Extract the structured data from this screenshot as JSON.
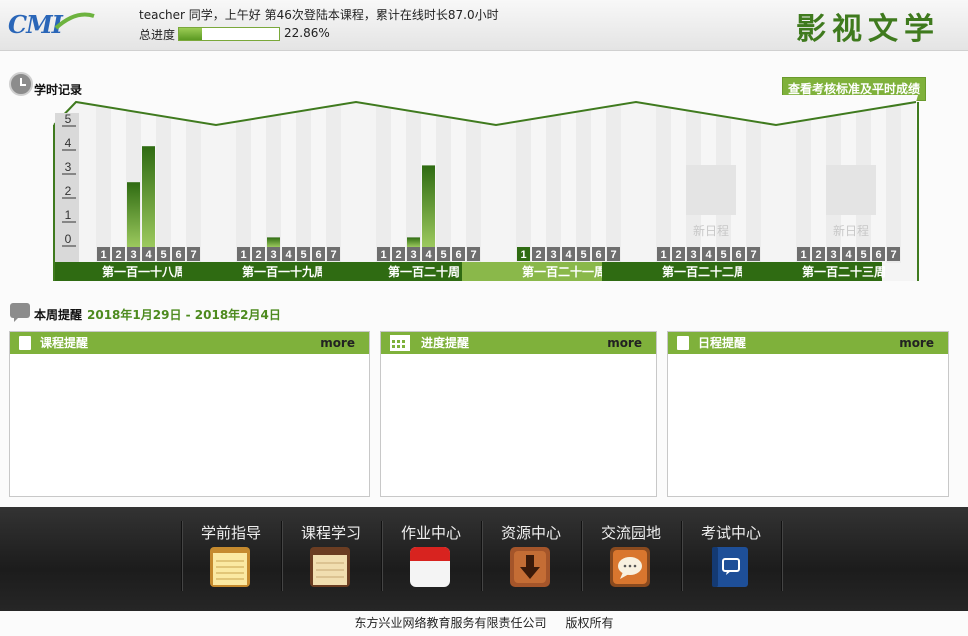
{
  "header": {
    "logo_text": "CMI",
    "welcome": "teacher 同学，上午好 第46次登陆本课程，累计在线时长87.0小时",
    "progress_label": "总进度",
    "progress_fraction": 0.2286,
    "progress_text": "22.86%",
    "course_title": "影视文学"
  },
  "study_record": {
    "title": "学时记录",
    "standards_button": "查看考核标准及平时成绩"
  },
  "chart_data": {
    "type": "bar",
    "y_ticks": [
      "0",
      "1",
      "2",
      "3",
      "4",
      "5"
    ],
    "ylim": [
      0,
      5
    ],
    "day_labels": [
      "1",
      "2",
      "3",
      "4",
      "5",
      "6",
      "7"
    ],
    "active_week_index": 3,
    "new_schedule_label": "新日程",
    "weeks": [
      {
        "name": "第一百一十八周",
        "values": [
          0,
          0,
          2.7,
          4.2,
          0,
          0,
          0
        ],
        "new_schedule": false
      },
      {
        "name": "第一百一十九周",
        "values": [
          0,
          0,
          0.4,
          0,
          0,
          0,
          0
        ],
        "new_schedule": false
      },
      {
        "name": "第一百二十周",
        "values": [
          0,
          0,
          0.4,
          3.4,
          0,
          0,
          0
        ],
        "new_schedule": false
      },
      {
        "name": "第一百二十一周",
        "values": [
          0,
          0,
          0,
          0,
          0,
          0,
          0
        ],
        "new_schedule": false
      },
      {
        "name": "第一百二十二周",
        "values": [
          0,
          0,
          0,
          0,
          0,
          0,
          0
        ],
        "new_schedule": true
      },
      {
        "name": "第一百二十三周",
        "values": [
          0,
          0,
          0,
          0,
          0,
          0,
          0
        ],
        "new_schedule": true
      }
    ]
  },
  "weekly": {
    "title": "本周提醒",
    "date_range": "2018年1月29日 - 2018年2月4日",
    "panels": [
      {
        "title": "课程提醒",
        "more": "more",
        "icon": "document-icon"
      },
      {
        "title": "进度提醒",
        "more": "more",
        "icon": "calendar-icon"
      },
      {
        "title": "日程提醒",
        "more": "more",
        "icon": "note-icon"
      }
    ]
  },
  "nav": [
    {
      "label": "学前指导",
      "icon": "notepad-icon"
    },
    {
      "label": "课程学习",
      "icon": "book-icon"
    },
    {
      "label": "作业中心",
      "icon": "calendar-icon"
    },
    {
      "label": "资源中心",
      "icon": "download-icon"
    },
    {
      "label": "交流园地",
      "icon": "chat-icon"
    },
    {
      "label": "考试中心",
      "icon": "exam-book-icon"
    }
  ],
  "footer": {
    "copyright": "东方兴业网络教育服务有限责任公司     版权所有"
  },
  "colors": {
    "accent": "#7fb13b",
    "dark_green": "#2f6b12",
    "active_week": "#8ab84a"
  }
}
